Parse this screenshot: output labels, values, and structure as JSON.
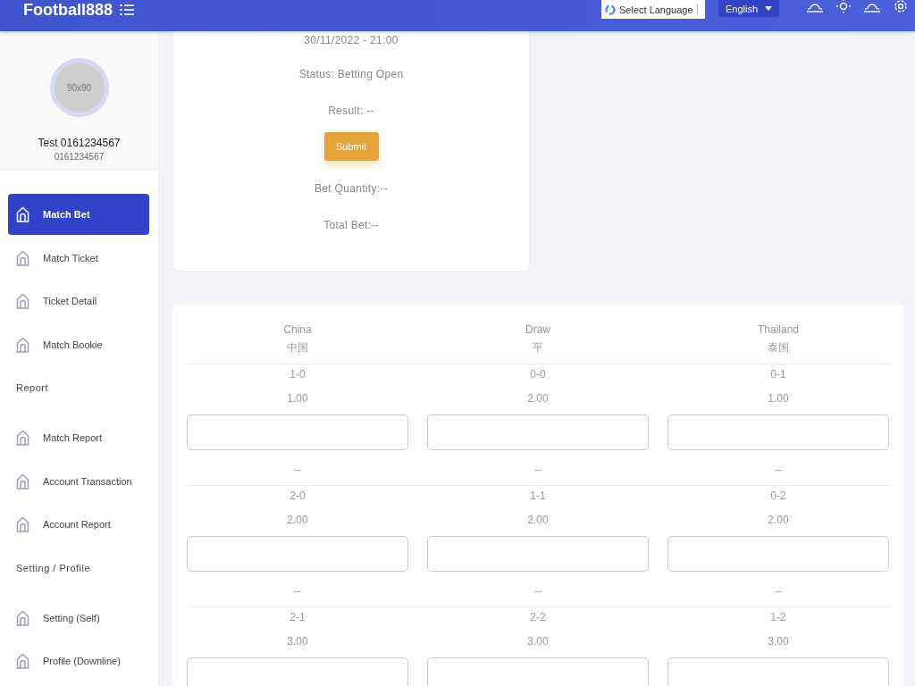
{
  "header": {
    "logo": "Football888",
    "language_selector": "Select Language",
    "language": "English"
  },
  "profile": {
    "avatar_label": "90x90",
    "name": "Test 0161234567",
    "phone": "0161234567"
  },
  "sidebar": {
    "items": [
      {
        "kind": "item",
        "label": "Match Bet",
        "selected": true
      },
      {
        "kind": "item",
        "label": "Match Ticket",
        "selected": false
      },
      {
        "kind": "item",
        "label": "Ticket Detail",
        "selected": false
      },
      {
        "kind": "item",
        "label": "Match Bookie",
        "selected": false
      },
      {
        "kind": "section",
        "label": "Report"
      },
      {
        "kind": "item",
        "label": "Match Report",
        "selected": false
      },
      {
        "kind": "item",
        "label": "Account Transaction",
        "selected": false
      },
      {
        "kind": "item",
        "label": "Account Report",
        "selected": false
      },
      {
        "kind": "section",
        "label": "Setting / Profile"
      },
      {
        "kind": "item",
        "label": "Setting (Self)",
        "selected": false
      },
      {
        "kind": "item",
        "label": "Profile (Downline)",
        "selected": false
      }
    ]
  },
  "match": {
    "datetime": "30/11/2022 - 21:00",
    "status": "Status: Betting Open",
    "result": "Result: --",
    "submit": "Submit",
    "bet_quantity": "Bet Quantity:--",
    "total_bet": "Total Bet:--"
  },
  "bet_table": {
    "columns": [
      {
        "name": "China",
        "name_local": "中国"
      },
      {
        "name": "Draw",
        "name_local": "平"
      },
      {
        "name": "Thailand",
        "name_local": "泰国"
      }
    ],
    "groups": [
      {
        "cells": [
          {
            "score": "1-0",
            "odds": "1.00",
            "result": "--"
          },
          {
            "score": "0-0",
            "odds": "2.00",
            "result": "--"
          },
          {
            "score": "0-1",
            "odds": "1.00",
            "result": "--"
          }
        ]
      },
      {
        "cells": [
          {
            "score": "2-0",
            "odds": "2.00",
            "result": "--"
          },
          {
            "score": "1-1",
            "odds": "2.00",
            "result": "--"
          },
          {
            "score": "0-2",
            "odds": "2.00",
            "result": "--"
          }
        ]
      },
      {
        "cells": [
          {
            "score": "2-1",
            "odds": "3.00"
          },
          {
            "score": "2-2",
            "odds": "3.00"
          },
          {
            "score": "1-2",
            "odds": "3.00"
          }
        ]
      }
    ]
  }
}
